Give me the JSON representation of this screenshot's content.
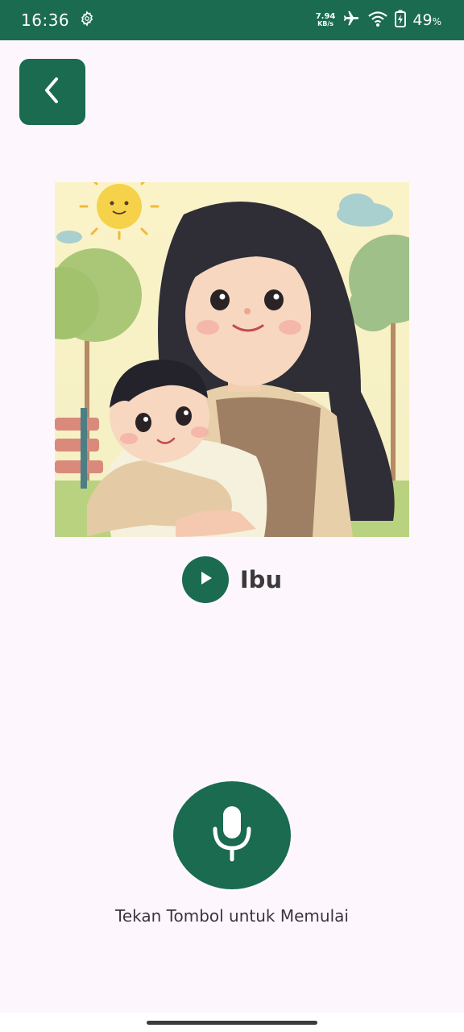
{
  "status_bar": {
    "time": "16:36",
    "net_speed_value": "7.94",
    "net_speed_unit": "KB/s",
    "battery_percent": "49",
    "battery_unit": "%",
    "icons": [
      "settings-gear-icon",
      "airplane-mode-icon",
      "wifi-icon",
      "battery-icon"
    ]
  },
  "header": {
    "back_icon": "chevron-left-icon"
  },
  "card": {
    "image_subject": "mother-holding-baby-illustration",
    "word": "Ibu",
    "play_icon": "play-icon"
  },
  "recorder": {
    "mic_icon": "microphone-icon",
    "hint": "Tekan Tombol untuk Memulai"
  },
  "colors": {
    "primary": "#1a6b4f",
    "background": "#fdf7fd",
    "text": "#3b3440"
  }
}
